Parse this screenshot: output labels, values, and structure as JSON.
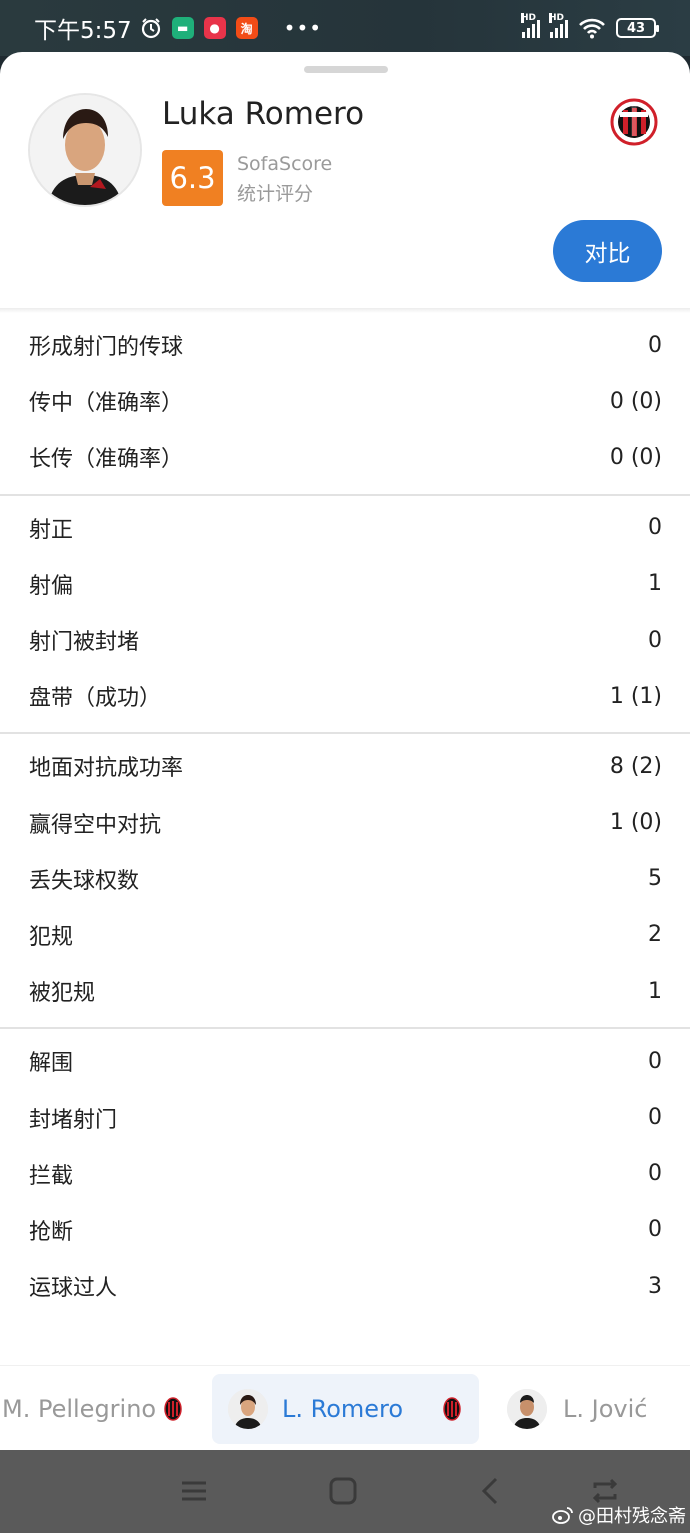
{
  "status_bar": {
    "time": "下午5:57",
    "signal_label": "HD",
    "battery": "43"
  },
  "player": {
    "name": "Luka Romero",
    "rating": "6.3",
    "rating_source": "SofaScore",
    "rating_caption": "统计评分",
    "compare_label": "对比"
  },
  "stat_groups": [
    [
      {
        "label": "形成射门的传球",
        "value": "0"
      },
      {
        "label": "传中（准确率）",
        "value": "0 (0)"
      },
      {
        "label": "长传（准确率）",
        "value": "0 (0)"
      }
    ],
    [
      {
        "label": "射正",
        "value": "0"
      },
      {
        "label": "射偏",
        "value": "1"
      },
      {
        "label": "射门被封堵",
        "value": "0"
      },
      {
        "label": "盘带（成功）",
        "value": "1 (1)"
      }
    ],
    [
      {
        "label": "地面对抗成功率",
        "value": "8 (2)"
      },
      {
        "label": "赢得空中对抗",
        "value": "1 (0)"
      },
      {
        "label": "丢失球权数",
        "value": "5"
      },
      {
        "label": "犯规",
        "value": "2"
      },
      {
        "label": "被犯规",
        "value": "1"
      }
    ],
    [
      {
        "label": "解围",
        "value": "0"
      },
      {
        "label": "封堵射门",
        "value": "0"
      },
      {
        "label": "拦截",
        "value": "0"
      },
      {
        "label": "抢断",
        "value": "0"
      },
      {
        "label": "运球过人",
        "value": "3"
      }
    ]
  ],
  "switcher": {
    "prev": "M. Pellegrino",
    "current": "L. Romero",
    "next": "L. Jović"
  },
  "watermark": "@田村残念斋",
  "colors": {
    "accent": "#2b7ad6",
    "rating_badge": "#f08022",
    "club_red": "#d0202a"
  }
}
